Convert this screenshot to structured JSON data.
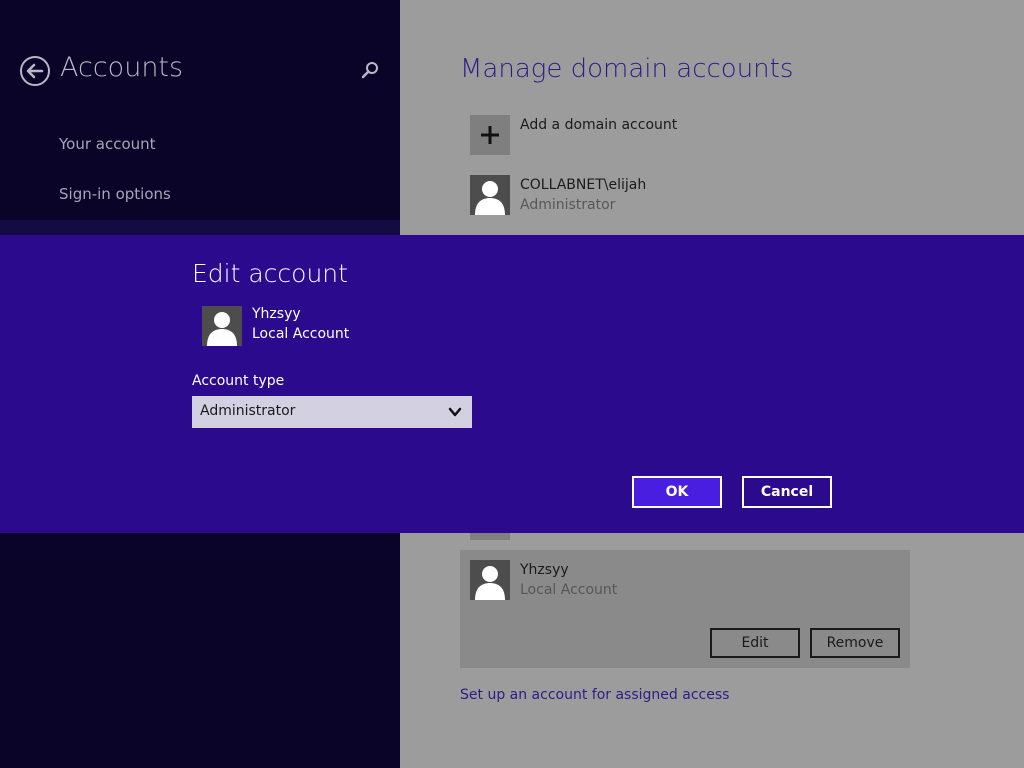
{
  "nav": {
    "title": "Accounts",
    "items": [
      {
        "label": "Your account"
      },
      {
        "label": "Sign-in options"
      }
    ]
  },
  "main": {
    "title": "Manage domain accounts",
    "add_label": "Add a domain account",
    "accounts": [
      {
        "name": "COLLABNET\\elijah",
        "type": "Administrator"
      },
      {
        "name": "Yhzsyy",
        "type": "Local Account"
      }
    ],
    "selected_actions": {
      "edit": "Edit",
      "remove": "Remove"
    },
    "assigned_access_link": "Set up an account for assigned access"
  },
  "dialog": {
    "title": "Edit account",
    "user_name": "Yhzsyy",
    "user_type": "Local Account",
    "account_type_label": "Account type",
    "account_type_value": "Administrator",
    "ok_label": "OK",
    "cancel_label": "Cancel"
  },
  "colors": {
    "nav_background": "#0a0428",
    "dialog_background": "#2b0a8e",
    "accent": "#4a1ee0",
    "link": "#2d1c86"
  },
  "icons": {
    "back": "back-arrow-icon",
    "search": "search-icon",
    "add": "plus-icon",
    "avatar": "user-icon",
    "dropdown": "chevron-down-icon"
  }
}
